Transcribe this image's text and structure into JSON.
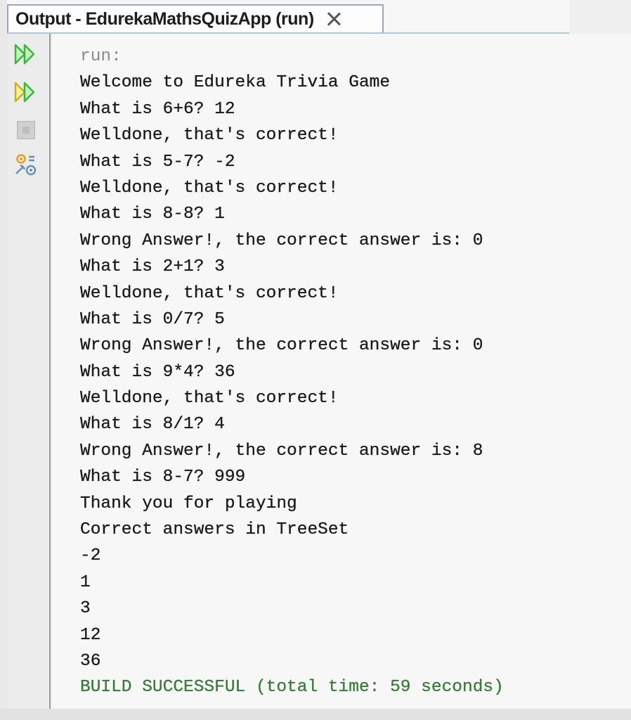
{
  "tab": {
    "title": "Output - EdurekaMathsQuizApp (run)"
  },
  "toolbar": {
    "icons": [
      "rerun-icon",
      "rerun-with-options-icon",
      "stop-icon",
      "settings-icon"
    ]
  },
  "console": {
    "lines": [
      {
        "text": "run:",
        "style": "gray"
      },
      {
        "text": "Welcome to Edureka Trivia Game",
        "style": "normal"
      },
      {
        "text": "What is 6+6? 12",
        "style": "normal"
      },
      {
        "text": "Welldone, that's correct!",
        "style": "normal"
      },
      {
        "text": "What is 5-7? -2",
        "style": "normal"
      },
      {
        "text": "Welldone, that's correct!",
        "style": "normal"
      },
      {
        "text": "What is 8-8? 1",
        "style": "normal"
      },
      {
        "text": "Wrong Answer!, the correct answer is: 0",
        "style": "normal"
      },
      {
        "text": "What is 2+1? 3",
        "style": "normal"
      },
      {
        "text": "Welldone, that's correct!",
        "style": "normal"
      },
      {
        "text": "What is 0/7? 5",
        "style": "normal"
      },
      {
        "text": "Wrong Answer!, the correct answer is: 0",
        "style": "normal"
      },
      {
        "text": "What is 9*4? 36",
        "style": "normal"
      },
      {
        "text": "Welldone, that's correct!",
        "style": "normal"
      },
      {
        "text": "What is 8/1? 4",
        "style": "normal"
      },
      {
        "text": "Wrong Answer!, the correct answer is: 8",
        "style": "normal"
      },
      {
        "text": "What is 8-7? 999",
        "style": "normal"
      },
      {
        "text": "Thank you for playing",
        "style": "normal"
      },
      {
        "text": "Correct answers in TreeSet",
        "style": "normal"
      },
      {
        "text": "-2",
        "style": "normal"
      },
      {
        "text": "1",
        "style": "normal"
      },
      {
        "text": "3",
        "style": "normal"
      },
      {
        "text": "12",
        "style": "normal"
      },
      {
        "text": "36",
        "style": "normal"
      },
      {
        "text": "BUILD SUCCESSFUL (total time: 59 seconds)",
        "style": "green"
      }
    ]
  },
  "colors": {
    "console_text": "#1b1b1b",
    "run_label": "#8a8a8a",
    "build_success": "#3a7a3a",
    "rerun_icon": "#3bb53b",
    "tab_border": "#9aa9bd"
  }
}
